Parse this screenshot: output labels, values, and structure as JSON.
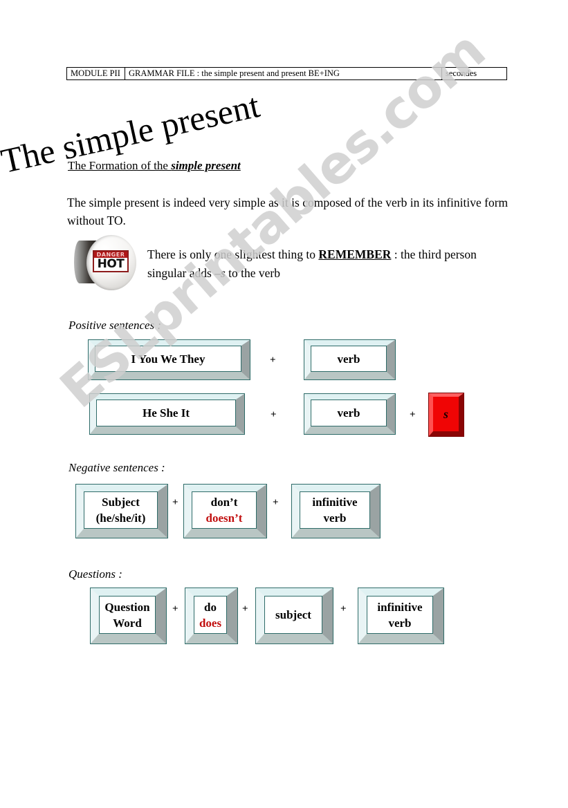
{
  "header": {
    "module": "MODULE PII",
    "grammar_file": "GRAMMAR FILE : the simple present and present BE+ING",
    "duration": "secondes"
  },
  "title": "The simple present",
  "formation_heading": {
    "plain": "The Formation of the ",
    "emphasis": "simple present"
  },
  "intro_paragraph": "The simple present is indeed very simple as it is composed of the verb in its infinitive form without TO.",
  "remember": {
    "badge": {
      "danger_label": "DANGER",
      "hot_label": "HOT"
    },
    "text_before": "There is only one slightest thing to ",
    "keyword": "REMEMBER",
    "text_middle": " : the third person singular adds ",
    "suffix": "–s",
    "text_after": " to the verb"
  },
  "sections": [
    {
      "label": "Positive sentences :",
      "rows": [
        {
          "items": [
            {
              "kind": "box",
              "lines": [
                "I    You    We    They"
              ]
            },
            {
              "kind": "plus",
              "text": "+"
            },
            {
              "kind": "box",
              "lines": [
                "verb"
              ]
            }
          ]
        },
        {
          "items": [
            {
              "kind": "box",
              "lines": [
                "He    She    It"
              ]
            },
            {
              "kind": "plus",
              "text": "+"
            },
            {
              "kind": "box",
              "lines": [
                "verb"
              ]
            },
            {
              "kind": "plus",
              "text": "+"
            },
            {
              "kind": "key",
              "text": "s"
            }
          ]
        }
      ]
    },
    {
      "label": "Negative sentences :",
      "rows": [
        {
          "items": [
            {
              "kind": "box",
              "lines": [
                "Subject",
                "(he/she/it)"
              ]
            },
            {
              "kind": "plus",
              "text": "+"
            },
            {
              "kind": "box",
              "lines": [
                "don’t",
                "doesn’t"
              ],
              "red_lines": [
                1
              ]
            },
            {
              "kind": "plus",
              "text": "+"
            },
            {
              "kind": "box",
              "lines": [
                "infinitive",
                "verb"
              ]
            }
          ]
        }
      ]
    },
    {
      "label": "Questions :",
      "rows": [
        {
          "items": [
            {
              "kind": "box",
              "lines": [
                "Question",
                "Word"
              ]
            },
            {
              "kind": "plus",
              "text": "+"
            },
            {
              "kind": "box",
              "lines": [
                "do",
                "does"
              ],
              "red_lines": [
                1
              ]
            },
            {
              "kind": "plus",
              "text": "+"
            },
            {
              "kind": "box",
              "lines": [
                "subject"
              ]
            },
            {
              "kind": "plus",
              "text": "+"
            },
            {
              "kind": "box",
              "lines": [
                "infinitive",
                "verb"
              ]
            }
          ]
        }
      ]
    }
  ],
  "watermark": "ESLprintables.com",
  "colors": {
    "accent_red": "#c10f0f",
    "key_red": "#f00505",
    "box_border": "#2e6b68",
    "bevel_light": "#e9f4f5",
    "bevel_dark": "#9aa3a3",
    "watermark": "#cfcfcf"
  }
}
